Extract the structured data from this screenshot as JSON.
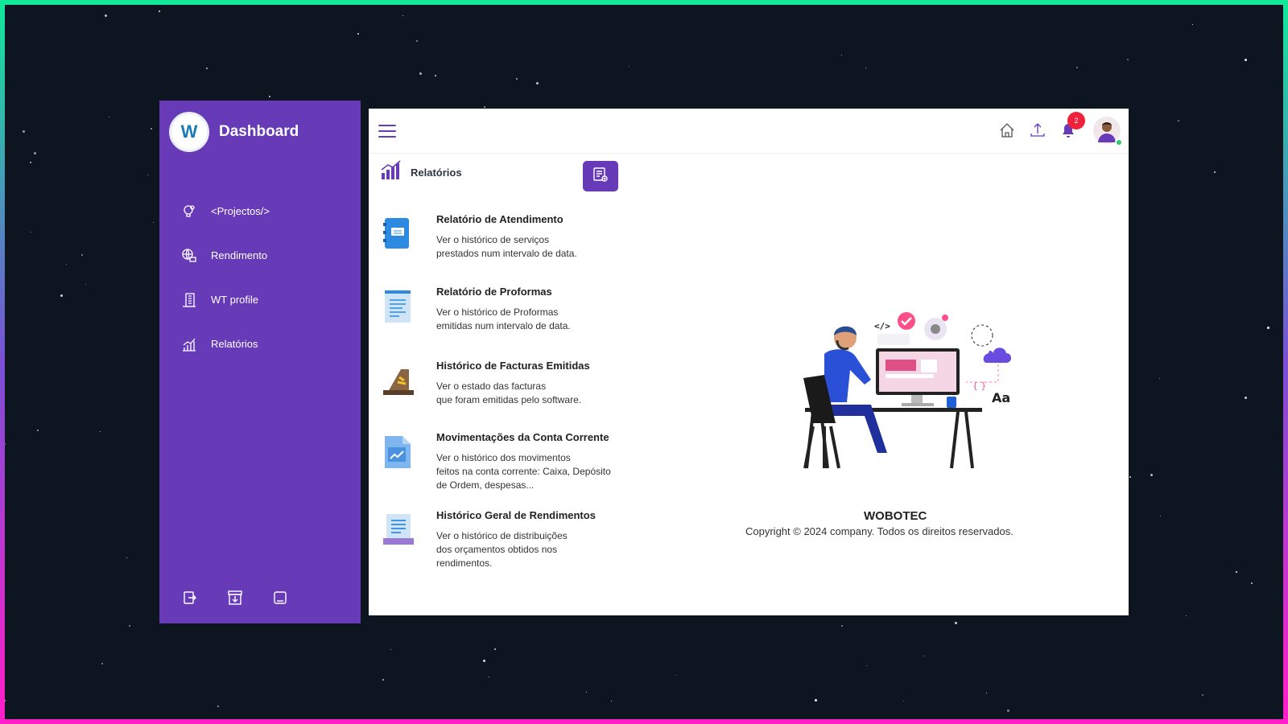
{
  "sidebar": {
    "logo_text": "W",
    "title": "Dashboard",
    "items": [
      {
        "label": "<Projectos/>",
        "icon": "lightbulb-gear-icon"
      },
      {
        "label": "Rendimento",
        "icon": "globe-money-icon"
      },
      {
        "label": "WT profile",
        "icon": "building-icon"
      },
      {
        "label": "Relatórios",
        "icon": "bar-chart-icon"
      }
    ],
    "bottom_icons": [
      "logout-icon",
      "archive-download-icon",
      "minimize-icon"
    ]
  },
  "topbar": {
    "menu_icon": "hamburger-menu-icon",
    "icons": [
      "home-icon",
      "upload-icon",
      "bell-icon"
    ],
    "notification_count": "2",
    "avatar_icon": "user-avatar-icon",
    "online_color": "#2bc96a"
  },
  "section": {
    "title": "Relatórios",
    "icon": "analytics-chart-icon",
    "action_icon": "report-settings-icon"
  },
  "reports": [
    {
      "title": "Relatório de Atendimento",
      "description": "Ver o histórico de serviços\nprestados num intervalo de data.",
      "icon": "notebook-icon"
    },
    {
      "title": "Relatório de Proformas",
      "description": "Ver o histórico de Proformas\nemitidas num intervalo de data.",
      "icon": "document-lines-icon"
    },
    {
      "title": "Histórico de Facturas Emitidas",
      "description": "Ver o estado das facturas\nque foram emitidas pelo software.",
      "icon": "cash-register-icon"
    },
    {
      "title": "Movimentações da Conta Corrente",
      "description": "Ver o histórico dos movimentos\nfeitos na conta corrente: Caixa, Depósito\nde Ordem, despesas...",
      "icon": "trend-document-icon"
    },
    {
      "title": "Histórico Geral de Rendimentos",
      "description": "Ver o histórico de distribuições\ndos orçamentos obtidos nos\nrendimentos.",
      "icon": "receipt-icon"
    }
  ],
  "illustration": {
    "icon": "developer-illustration",
    "code_text": "</>",
    "font_text": "Aa",
    "brace_text": "{ }"
  },
  "footer": {
    "company": "WOBOTEC",
    "copyright": "Copyright ©  2024 company. Todos os direitos reservados."
  },
  "colors": {
    "primary": "#673ab7",
    "badge": "#f0213b",
    "background": "#0d1520"
  }
}
